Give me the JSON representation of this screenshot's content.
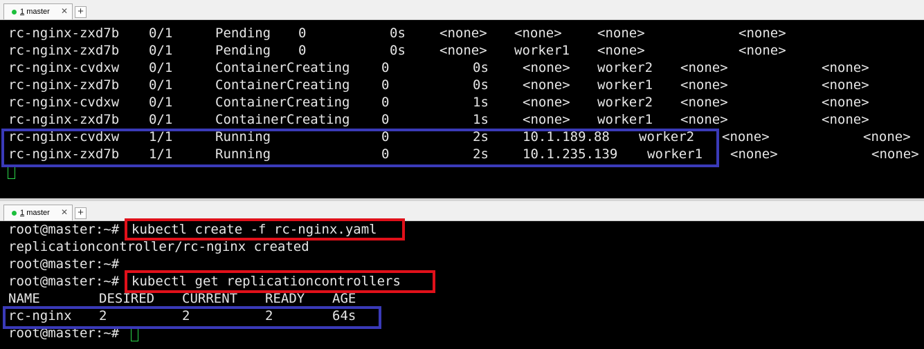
{
  "colors": {
    "highlight_red": "#e0101a",
    "highlight_blue": "#3a3ab8",
    "cursor": "#2bd94a",
    "tab_status": "#1cbf3c"
  },
  "top_pane": {
    "tab": {
      "index": "1",
      "label": "master",
      "close_icon": "close-icon",
      "add_icon": "plus-icon"
    },
    "rows": [
      {
        "name": "rc-nginx-zxd7b",
        "ready": "0/1",
        "status": "Pending",
        "restarts": "0",
        "age": "0s",
        "ip": "<none>",
        "node": "<none>",
        "nominated": "<none>",
        "gates": "<none>"
      },
      {
        "name": "rc-nginx-zxd7b",
        "ready": "0/1",
        "status": "Pending",
        "restarts": "0",
        "age": "0s",
        "ip": "<none>",
        "node": "worker1",
        "nominated": "<none>",
        "gates": "<none>"
      },
      {
        "name": "rc-nginx-cvdxw",
        "ready": "0/1",
        "status": "ContainerCreating",
        "restarts": "0",
        "age": "0s",
        "ip": "<none>",
        "node": "worker2",
        "nominated": "<none>",
        "gates": "<none>"
      },
      {
        "name": "rc-nginx-zxd7b",
        "ready": "0/1",
        "status": "ContainerCreating",
        "restarts": "0",
        "age": "0s",
        "ip": "<none>",
        "node": "worker1",
        "nominated": "<none>",
        "gates": "<none>"
      },
      {
        "name": "rc-nginx-cvdxw",
        "ready": "0/1",
        "status": "ContainerCreating",
        "restarts": "0",
        "age": "1s",
        "ip": "<none>",
        "node": "worker2",
        "nominated": "<none>",
        "gates": "<none>"
      },
      {
        "name": "rc-nginx-zxd7b",
        "ready": "0/1",
        "status": "ContainerCreating",
        "restarts": "0",
        "age": "1s",
        "ip": "<none>",
        "node": "worker1",
        "nominated": "<none>",
        "gates": "<none>"
      },
      {
        "name": "rc-nginx-cvdxw",
        "ready": "1/1",
        "status": "Running",
        "restarts": "0",
        "age": "2s",
        "ip": "10.1.189.88",
        "node": "worker2",
        "nominated": "<none>",
        "gates": "<none>"
      },
      {
        "name": "rc-nginx-zxd7b",
        "ready": "1/1",
        "status": "Running",
        "restarts": "0",
        "age": "2s",
        "ip": "10.1.235.139",
        "node": "worker1",
        "nominated": "<none>",
        "gates": "<none>"
      }
    ]
  },
  "bottom_pane": {
    "tab": {
      "index": "1",
      "label": "master",
      "close_icon": "close-icon",
      "add_icon": "plus-icon"
    },
    "prompt": "root@master:~#",
    "cmd1": "kubectl create -f rc-nginx.yaml",
    "out1": "replicationcontroller/rc-nginx created",
    "cmd2": "kubectl get replicationcontrollers",
    "headers": [
      "NAME",
      "DESIRED",
      "CURRENT",
      "READY",
      "AGE"
    ],
    "row": [
      "rc-nginx",
      "2",
      "2",
      "2",
      "64s"
    ]
  }
}
